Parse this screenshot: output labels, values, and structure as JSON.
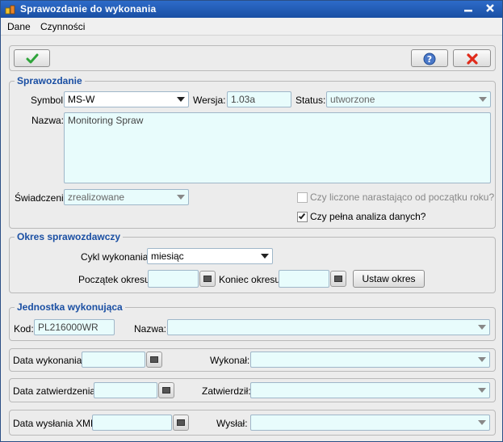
{
  "window": {
    "title": "Sprawozdanie do wykonania",
    "minimize_glyph": "▬",
    "close_glyph": "✕"
  },
  "menu": [
    {
      "label": "Dane"
    },
    {
      "label": "Czynności"
    }
  ],
  "toolbar": {
    "ok_icon": "checkmark-icon",
    "help_icon": "help-icon",
    "cancel_icon": "cancel-icon"
  },
  "sprawozdanie": {
    "title": "Sprawozdanie",
    "symbol_label": "Symbol:",
    "symbol_value": "MS-W",
    "wersja_label": "Wersja:",
    "wersja_value": "1.03a",
    "status_label": "Status:",
    "status_value": "utworzone",
    "nazwa_label": "Nazwa:",
    "nazwa_value": "Monitoring Spraw",
    "swiadczenia_label": "Świadczenia",
    "swiadczenia_value": "zrealizowane",
    "narastajaco_label": "Czy liczone narastająco od początku roku?",
    "narastajaco_checked": false,
    "pelna_label": "Czy pełna analiza danych?",
    "pelna_checked": true
  },
  "okres": {
    "title": "Okres sprawozdawczy",
    "cykl_label": "Cykl wykonania:",
    "cykl_value": "miesiąc",
    "poczatek_label": "Początek okresu:",
    "poczatek_value": "",
    "koniec_label": "Koniec okresu:",
    "koniec_value": "",
    "ustaw_label": "Ustaw okres"
  },
  "jednostka": {
    "title": "Jednostka wykonująca",
    "kod_label": "Kod:",
    "kod_value": "PL216000WR",
    "nazwa_label": "Nazwa:",
    "nazwa_value": ""
  },
  "wykonanie": {
    "data_label": "Data wykonania:",
    "data_value": "",
    "osoba_label": "Wykonał:",
    "osoba_value": ""
  },
  "zatwierdzenie": {
    "data_label": "Data zatwierdzenia:",
    "data_value": "",
    "osoba_label": "Zatwierdził:",
    "osoba_value": ""
  },
  "wyslanie": {
    "data_label": "Data wysłania XML:",
    "data_value": "",
    "osoba_label": "Wysłał:",
    "osoba_value": ""
  }
}
